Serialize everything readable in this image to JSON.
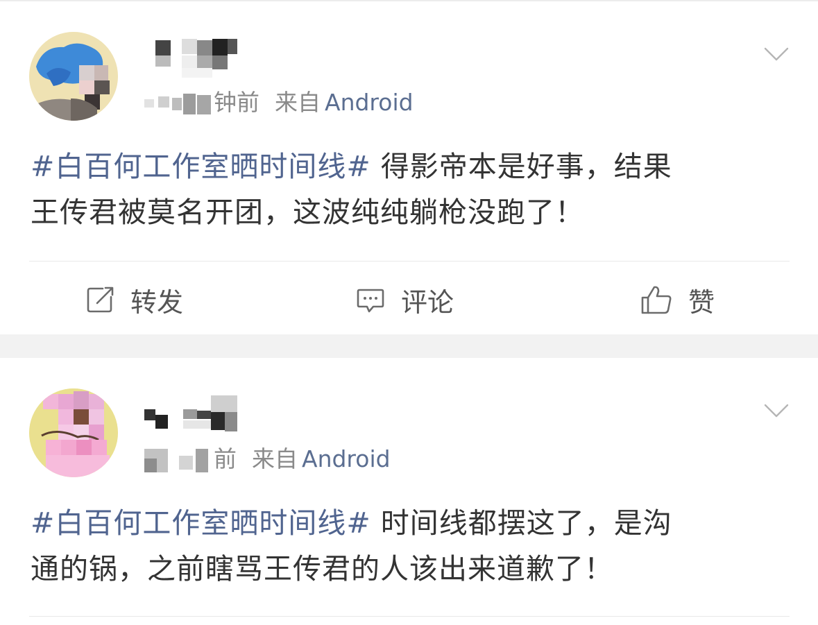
{
  "posts": [
    {
      "time_visible": "钟前",
      "source_prefix": "来自",
      "source_device": "Android",
      "topic": "#白百何工作室晒时间线#",
      "text_line1": " 得影帝本是好事，结果",
      "text_line2": "王传君被莫名开团，这波纯纯躺枪没跑了！"
    },
    {
      "time_visible": "前",
      "source_prefix": "来自",
      "source_device": "Android",
      "topic": "#白百何工作室晒时间线#",
      "text_line1": " 时间线都摆这了，是沟",
      "text_line2": "通的锅，之前瞎骂王传君的人该出来道歉了！"
    }
  ],
  "actions": {
    "repost_label": "转发",
    "comment_label": "评论",
    "like_label": "赞"
  },
  "colors": {
    "topic": "#50648f",
    "meta": "#8a8a8a",
    "source_device": "#5b6e91",
    "separator": "#f2f2f2"
  }
}
